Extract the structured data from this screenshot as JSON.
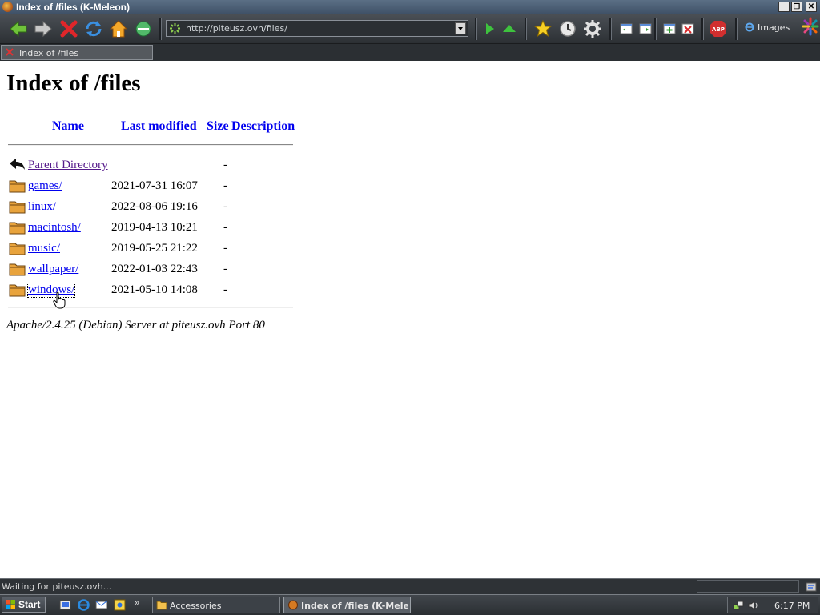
{
  "window": {
    "title": "Index of /files (K-Meleon)",
    "minimize": "_",
    "maximize": "❐",
    "close": "✕"
  },
  "toolbar": {
    "url": "http://piteusz.ovh/files/",
    "images_label": "Images",
    "icons": [
      "back-icon",
      "forward-icon",
      "stop-icon",
      "reload-icon",
      "home-icon",
      "go-icon",
      "next-icon",
      "up-icon",
      "bookmarks-icon",
      "history-icon",
      "preferences-icon",
      "layout-icon",
      "page-icon",
      "new-tab-icon",
      "close-tab-icon",
      "adblock-icon"
    ]
  },
  "tabs": [
    {
      "label": "Index of /files"
    }
  ],
  "page": {
    "heading": "Index of /files",
    "columns": {
      "name": "Name",
      "modified": "Last modified",
      "size": "Size",
      "description": "Description"
    },
    "rows": [
      {
        "name": "Parent Directory",
        "modified": "",
        "size": "-",
        "icon": "parent-directory-icon"
      },
      {
        "name": "games/",
        "modified": "2021-07-31 16:07",
        "size": "-",
        "icon": "folder-icon"
      },
      {
        "name": "linux/",
        "modified": "2022-08-06 19:16",
        "size": "-",
        "icon": "folder-icon"
      },
      {
        "name": "macintosh/",
        "modified": "2019-04-13 10:21",
        "size": "-",
        "icon": "folder-icon"
      },
      {
        "name": "music/",
        "modified": "2019-05-25 21:22",
        "size": "-",
        "icon": "folder-icon"
      },
      {
        "name": "wallpaper/",
        "modified": "2022-01-03 22:43",
        "size": "-",
        "icon": "folder-icon"
      },
      {
        "name": "windows/",
        "modified": "2021-05-10 14:08",
        "size": "-",
        "icon": "folder-icon"
      }
    ],
    "address": "Apache/2.4.25 (Debian) Server at piteusz.ovh Port 80"
  },
  "status": {
    "text": "Waiting for piteusz.ovh..."
  },
  "taskbar": {
    "start_label": "Start",
    "tasks": [
      {
        "label": "Accessories",
        "active": false
      },
      {
        "label": "Index of /files (K-Mele...",
        "active": true
      }
    ],
    "clock": "6:17 PM"
  },
  "colors": {
    "link": "#0000ee",
    "visited": "#551a8b",
    "chrome_dark": "#2b2f33",
    "title_bar": "#4d6077"
  }
}
